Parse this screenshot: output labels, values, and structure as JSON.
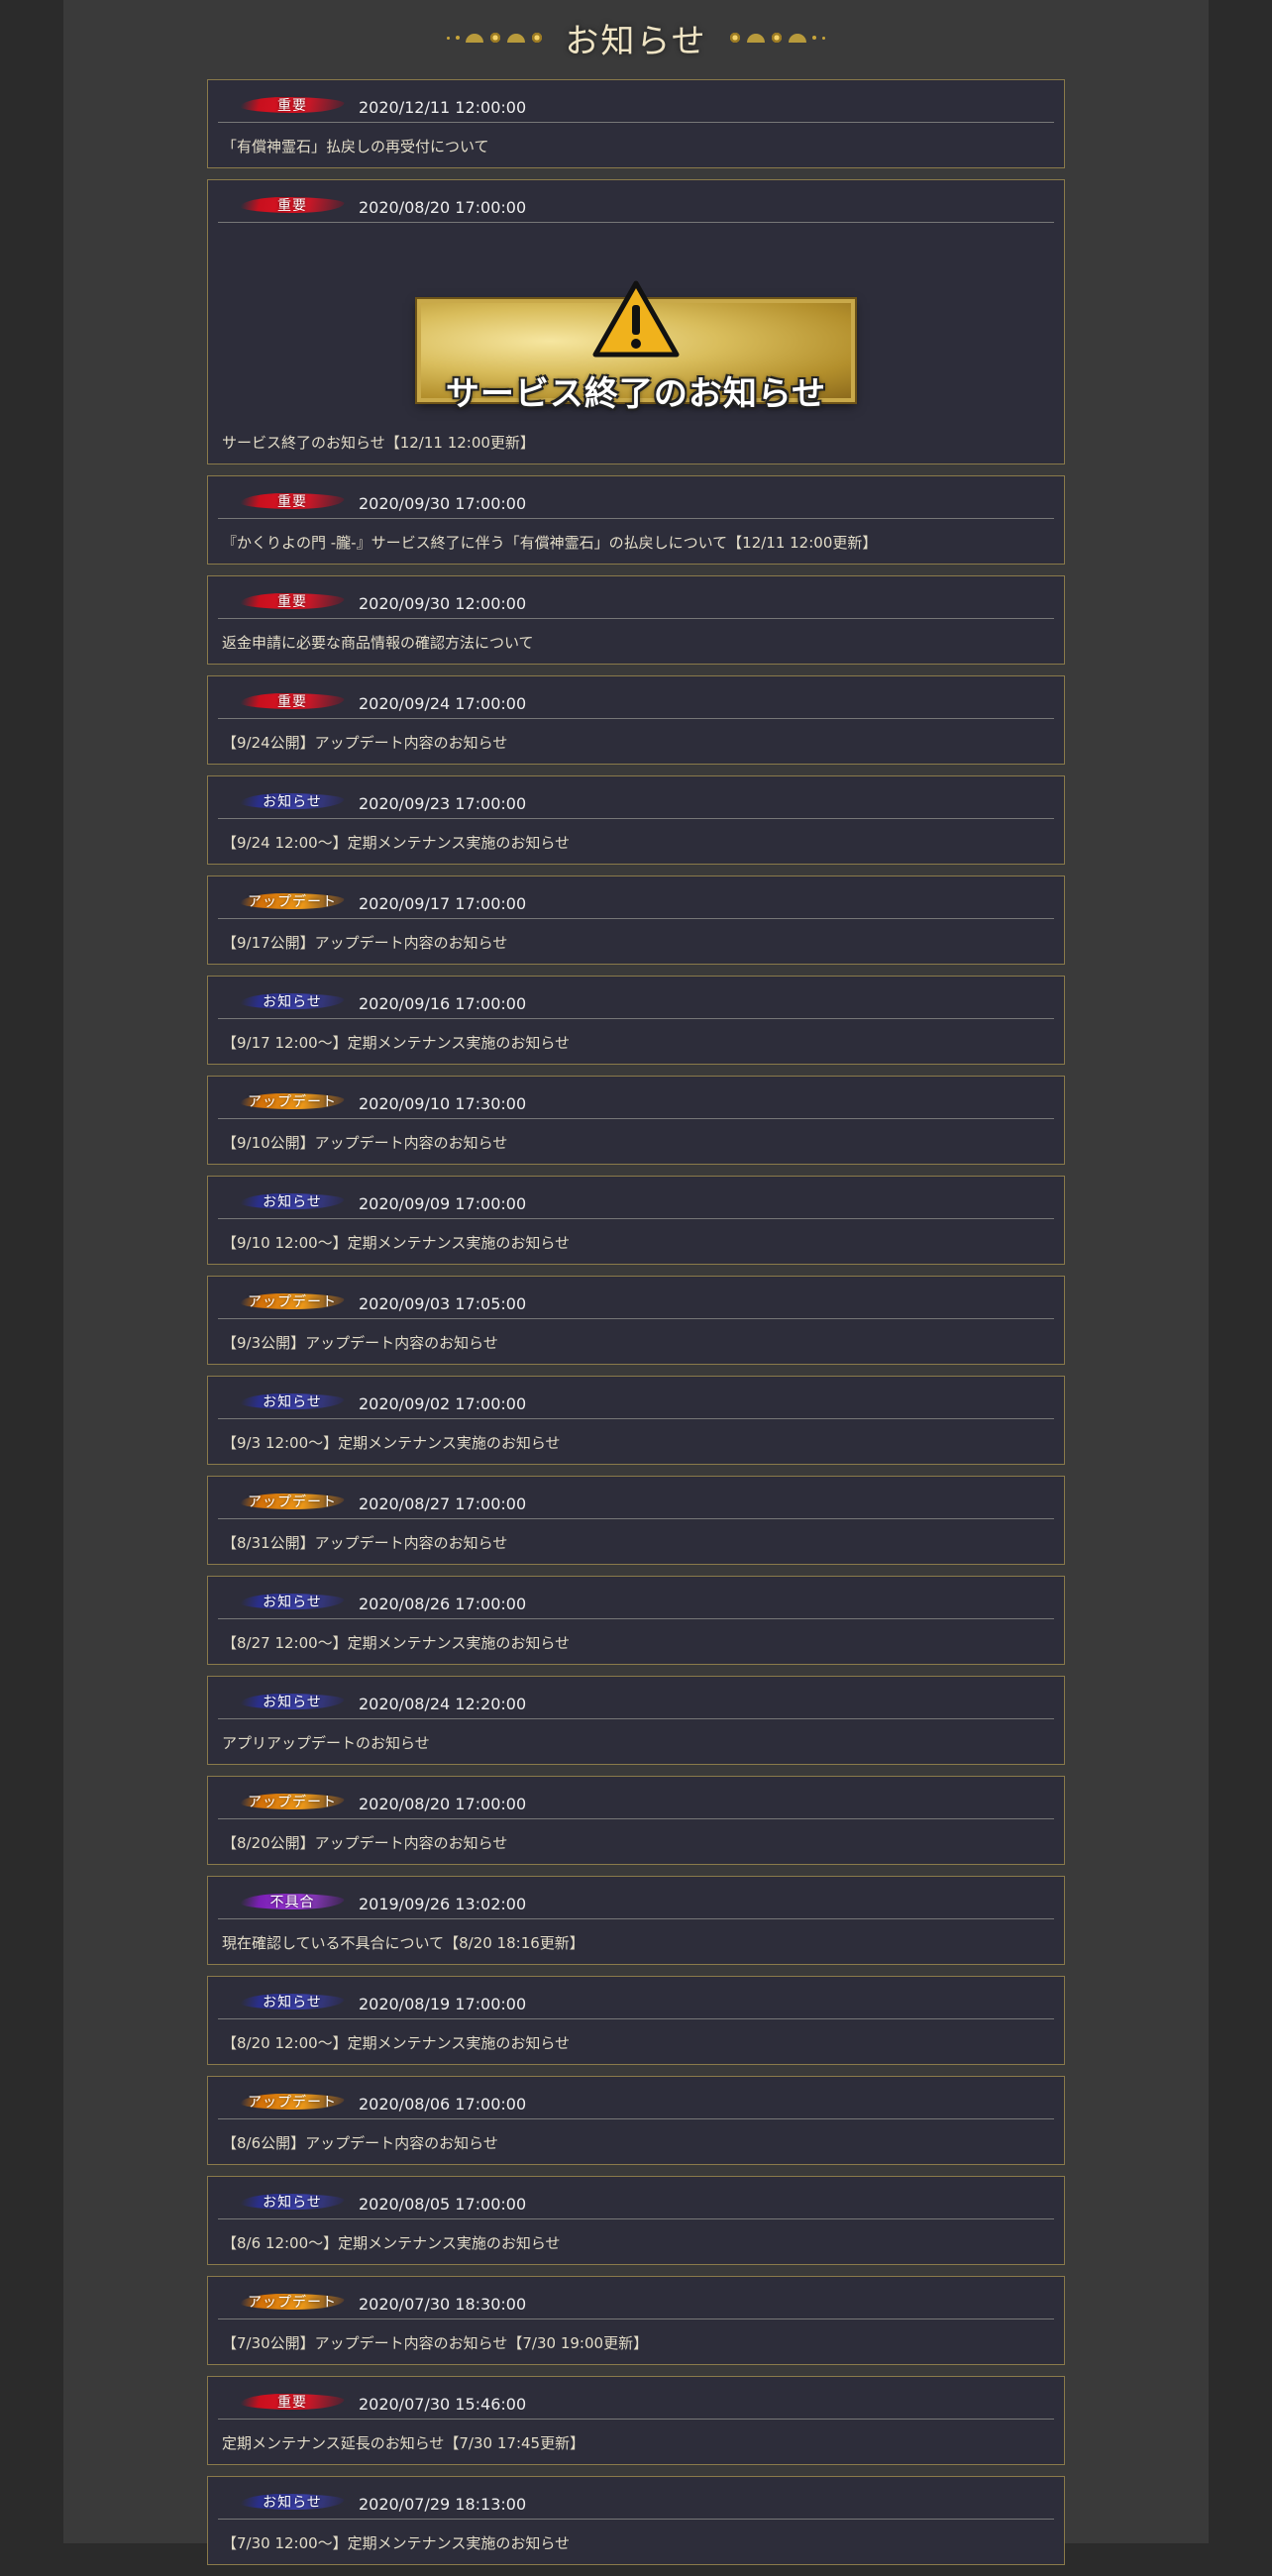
{
  "page": {
    "title": "お知らせ",
    "colors": {
      "important": "#c8101e",
      "notice": "#2a2f8a",
      "update": "#d26f08",
      "bug": "#7a1fb4",
      "card_border": "#8a7a4a",
      "card_bg": "#2d2d3a"
    }
  },
  "news": [
    {
      "category": "重要",
      "date": "2020/12/11 12:00:00",
      "title": "「有償神霊石」払戻しの再受付について"
    },
    {
      "category": "重要",
      "date": "2020/08/20 17:00:00",
      "title": "サービス終了のお知らせ【12/11 12:00更新】",
      "banner_text": "サービス終了のお知らせ",
      "banner_icon": "warning-icon"
    },
    {
      "category": "重要",
      "date": "2020/09/30 17:00:00",
      "title": "『かくりよの門 -朧-』サービス終了に伴う「有償神霊石」の払戻しについて【12/11 12:00更新】"
    },
    {
      "category": "重要",
      "date": "2020/09/30 12:00:00",
      "title": "返金申請に必要な商品情報の確認方法について"
    },
    {
      "category": "重要",
      "date": "2020/09/24 17:00:00",
      "title": "【9/24公開】アップデート内容のお知らせ"
    },
    {
      "category": "お知らせ",
      "date": "2020/09/23 17:00:00",
      "title": "【9/24 12:00～】定期メンテナンス実施のお知らせ"
    },
    {
      "category": "アップデート",
      "date": "2020/09/17 17:00:00",
      "title": "【9/17公開】アップデート内容のお知らせ"
    },
    {
      "category": "お知らせ",
      "date": "2020/09/16 17:00:00",
      "title": "【9/17 12:00～】定期メンテナンス実施のお知らせ"
    },
    {
      "category": "アップデート",
      "date": "2020/09/10 17:30:00",
      "title": "【9/10公開】アップデート内容のお知らせ"
    },
    {
      "category": "お知らせ",
      "date": "2020/09/09 17:00:00",
      "title": "【9/10 12:00～】定期メンテナンス実施のお知らせ"
    },
    {
      "category": "アップデート",
      "date": "2020/09/03 17:05:00",
      "title": "【9/3公開】アップデート内容のお知らせ"
    },
    {
      "category": "お知らせ",
      "date": "2020/09/02 17:00:00",
      "title": "【9/3 12:00～】定期メンテナンス実施のお知らせ"
    },
    {
      "category": "アップデート",
      "date": "2020/08/27 17:00:00",
      "title": "【8/31公開】アップデート内容のお知らせ"
    },
    {
      "category": "お知らせ",
      "date": "2020/08/26 17:00:00",
      "title": "【8/27 12:00～】定期メンテナンス実施のお知らせ"
    },
    {
      "category": "お知らせ",
      "date": "2020/08/24 12:20:00",
      "title": "アプリアップデートのお知らせ"
    },
    {
      "category": "アップデート",
      "date": "2020/08/20 17:00:00",
      "title": "【8/20公開】アップデート内容のお知らせ"
    },
    {
      "category": "不具合",
      "date": "2019/09/26 13:02:00",
      "title": "現在確認している不具合について【8/20 18:16更新】"
    },
    {
      "category": "お知らせ",
      "date": "2020/08/19 17:00:00",
      "title": "【8/20 12:00～】定期メンテナンス実施のお知らせ"
    },
    {
      "category": "アップデート",
      "date": "2020/08/06 17:00:00",
      "title": "【8/6公開】アップデート内容のお知らせ"
    },
    {
      "category": "お知らせ",
      "date": "2020/08/05 17:00:00",
      "title": "【8/6 12:00～】定期メンテナンス実施のお知らせ"
    },
    {
      "category": "アップデート",
      "date": "2020/07/30 18:30:00",
      "title": "【7/30公開】アップデート内容のお知らせ【7/30 19:00更新】"
    },
    {
      "category": "重要",
      "date": "2020/07/30 15:46:00",
      "title": "定期メンテナンス延長のお知らせ【7/30 17:45更新】"
    },
    {
      "category": "お知らせ",
      "date": "2020/07/29 18:13:00",
      "title": "【7/30 12:00～】定期メンテナンス実施のお知らせ"
    }
  ]
}
